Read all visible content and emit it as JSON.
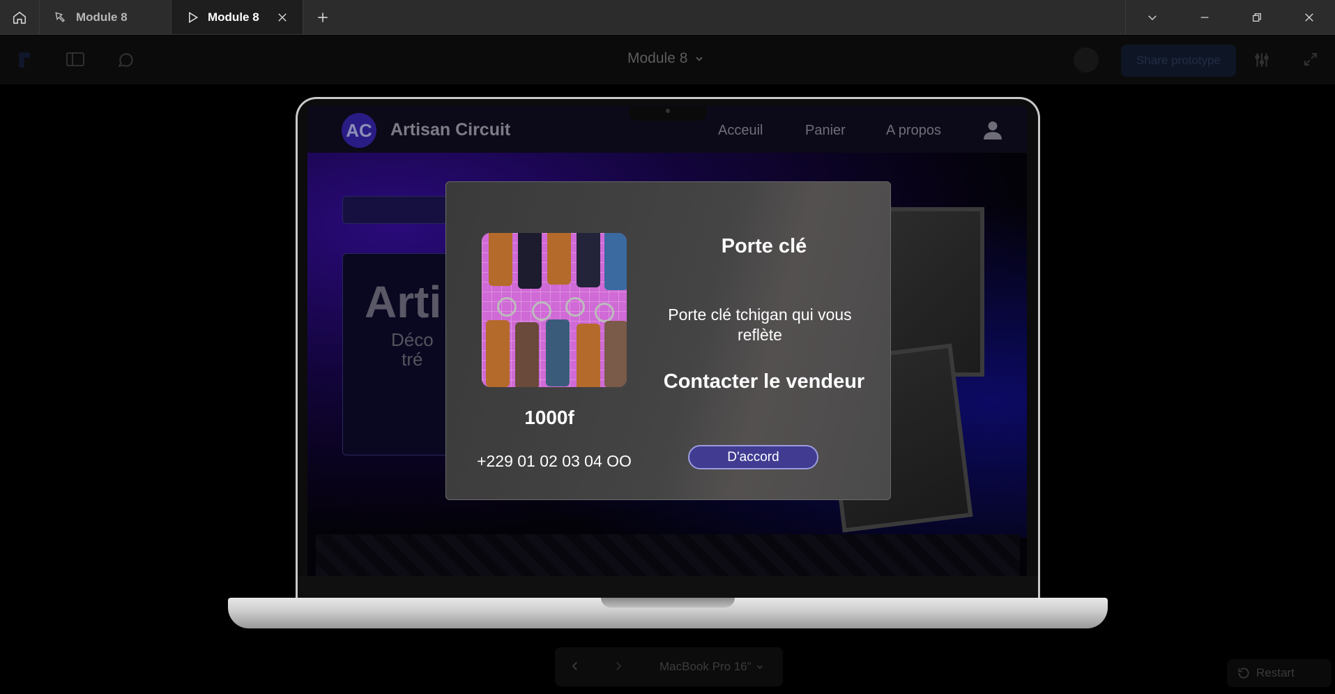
{
  "window": {
    "tabs": [
      {
        "label": "Module 8",
        "active": false
      },
      {
        "label": "Module 8",
        "active": true
      }
    ]
  },
  "prototype_toolbar": {
    "file_title": "Module 8",
    "share_label": "Share prototype"
  },
  "site": {
    "logo_text": "AC",
    "brand": "Artisan Circuit",
    "nav": [
      "Acceuil",
      "Panier",
      "A propos"
    ],
    "hero_title_partial": "Arti",
    "hero_sub_line1": "Déco",
    "hero_sub_line2": "tré"
  },
  "modal": {
    "title": "Porte clé",
    "description": "Porte clé tchigan qui vous reflète",
    "contact_label": "Contacter le vendeur",
    "price": "1000f",
    "phone": "+229 01 02 03 04 OO",
    "confirm_label": "D'accord"
  },
  "bottom_controls": {
    "device": "MacBook Pro 16\"",
    "restart_label": "Restart"
  },
  "colors": {
    "modal_button": "#413c92",
    "site_accent": "#2a1c85",
    "titlebar": "#2c2c2c"
  }
}
